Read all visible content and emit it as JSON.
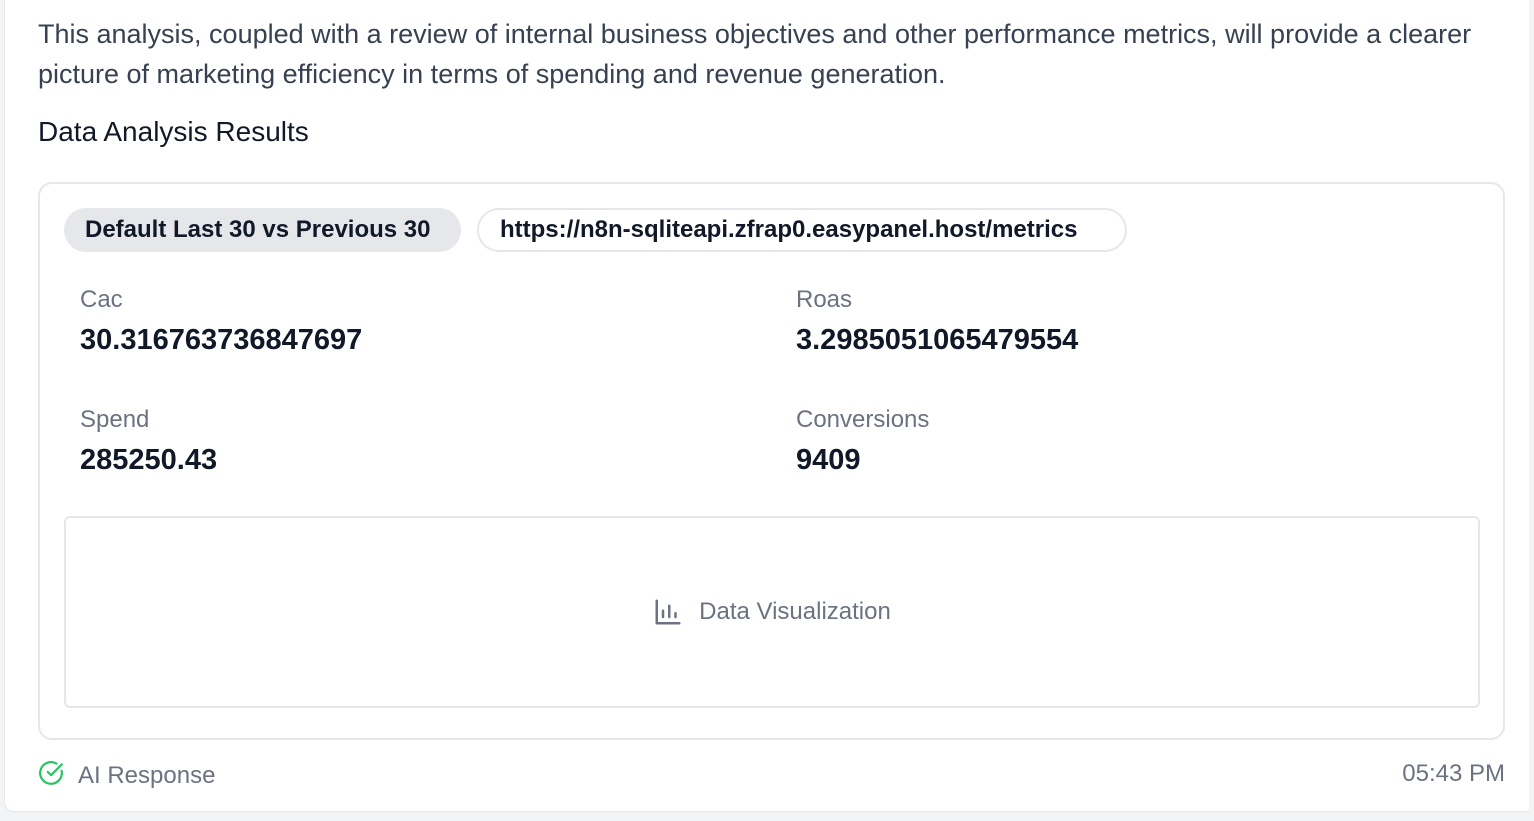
{
  "message": {
    "intro_text": "This analysis, coupled with a review of internal business objectives and other performance metrics, will provide a clearer picture of marketing efficiency in terms of spending and revenue generation.",
    "section_title": "Data Analysis Results"
  },
  "results": {
    "filter_chip": "Default Last 30 vs Previous 30",
    "url_chip": "https://n8n-sqliteapi.zfrap0.easypanel.host/metrics",
    "metrics": [
      {
        "label": "Cac",
        "value": "30.316763736847697"
      },
      {
        "label": "Roas",
        "value": "3.2985051065479554"
      },
      {
        "label": "Spend",
        "value": "285250.43"
      },
      {
        "label": "Conversions",
        "value": "9409"
      }
    ],
    "visualization": {
      "label": "Data Visualization",
      "icon": "bar-chart-icon"
    }
  },
  "footer": {
    "status_label": "AI Response",
    "status_icon": "check-circle-icon",
    "status_color": "#22c55e",
    "timestamp": "05:43 PM"
  }
}
